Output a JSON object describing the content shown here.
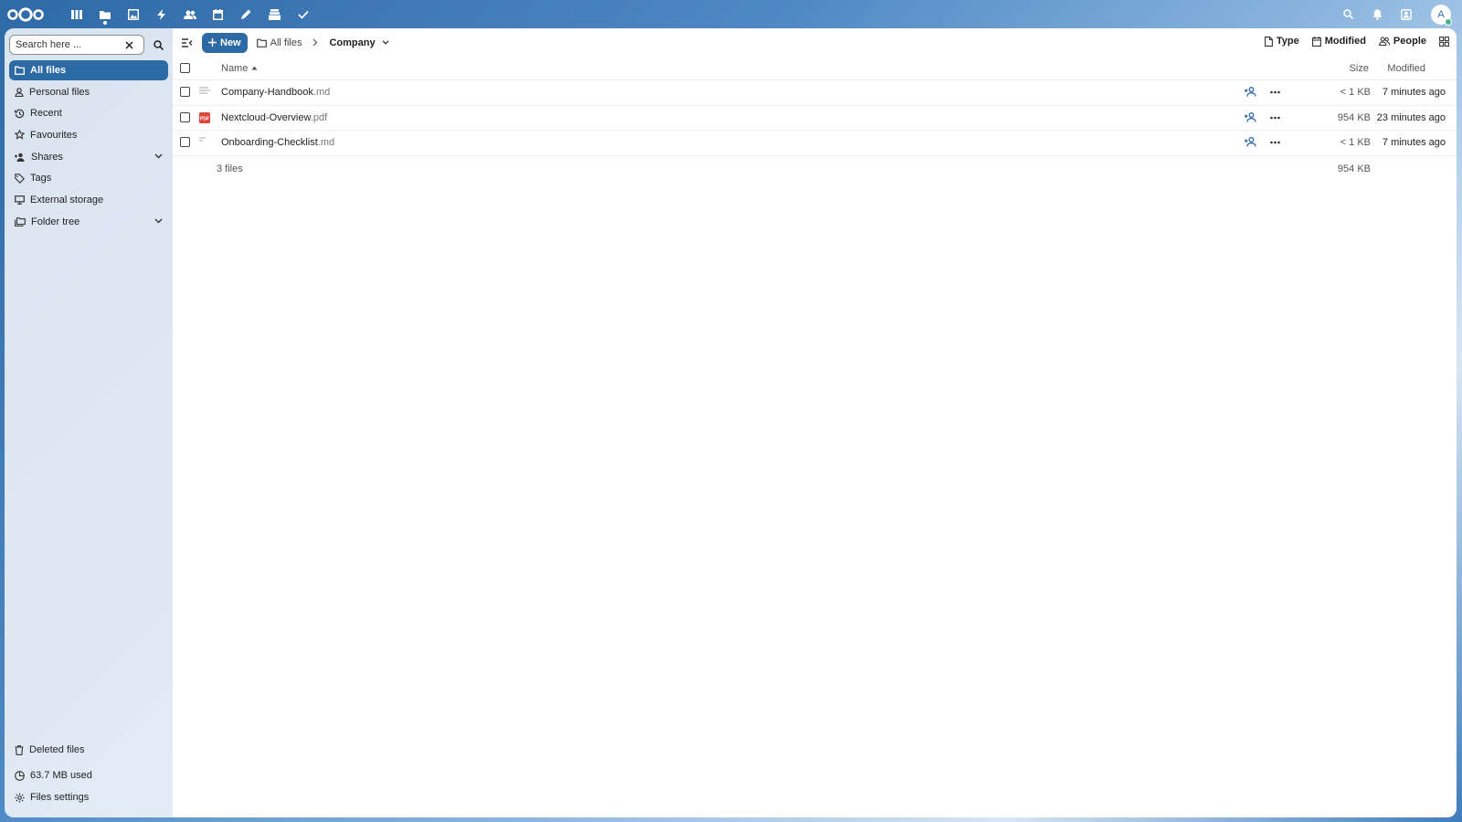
{
  "header": {
    "apps": [
      {
        "name": "dashboard",
        "icon": "dashboard-icon"
      },
      {
        "name": "files",
        "icon": "folder-icon",
        "active": true
      },
      {
        "name": "photos",
        "icon": "image-icon"
      },
      {
        "name": "activity",
        "icon": "lightning-icon"
      },
      {
        "name": "contacts",
        "icon": "people-icon"
      },
      {
        "name": "calendar",
        "icon": "calendar-icon"
      },
      {
        "name": "notes",
        "icon": "pencil-icon"
      },
      {
        "name": "deck",
        "icon": "stack-icon"
      },
      {
        "name": "tasks",
        "icon": "checkmark-icon"
      }
    ],
    "avatar_initial": "A"
  },
  "sidebar": {
    "search_placeholder": "Search here ...",
    "items": [
      {
        "label": "All files",
        "icon": "folder-icon",
        "active": true
      },
      {
        "label": "Personal files",
        "icon": "account-icon"
      },
      {
        "label": "Recent",
        "icon": "history-icon"
      },
      {
        "label": "Favourites",
        "icon": "star-icon"
      },
      {
        "label": "Shares",
        "icon": "share-icon",
        "expandable": true
      },
      {
        "label": "Tags",
        "icon": "tag-icon"
      },
      {
        "label": "External storage",
        "icon": "monitor-icon"
      },
      {
        "label": "Folder tree",
        "icon": "folder-multiple-icon",
        "expandable": true
      }
    ],
    "bottom": {
      "deleted": "Deleted files",
      "storage": "63.7 MB used",
      "settings": "Files settings"
    }
  },
  "toolbar": {
    "new_label": "New",
    "breadcrumb": [
      "All files",
      "Company"
    ],
    "filters": [
      "Type",
      "Modified",
      "People"
    ]
  },
  "table": {
    "columns": {
      "name": "Name",
      "size": "Size",
      "modified": "Modified"
    },
    "rows": [
      {
        "base": "Company-Handbook",
        "ext": ".md",
        "size": "< 1 KB",
        "modified": "7 minutes ago",
        "type": "md"
      },
      {
        "base": "Nextcloud-Overview",
        "ext": ".pdf",
        "size": "954 KB",
        "modified": "23 minutes ago",
        "type": "pdf"
      },
      {
        "base": "Onboarding-Checklist",
        "ext": ".md",
        "size": "< 1 KB",
        "modified": "7 minutes ago",
        "type": "md"
      }
    ],
    "summary": {
      "count": "3 files",
      "total": "954 KB"
    }
  },
  "colors": {
    "accent": "#2c6aa6",
    "pdf": "#e0463c"
  }
}
